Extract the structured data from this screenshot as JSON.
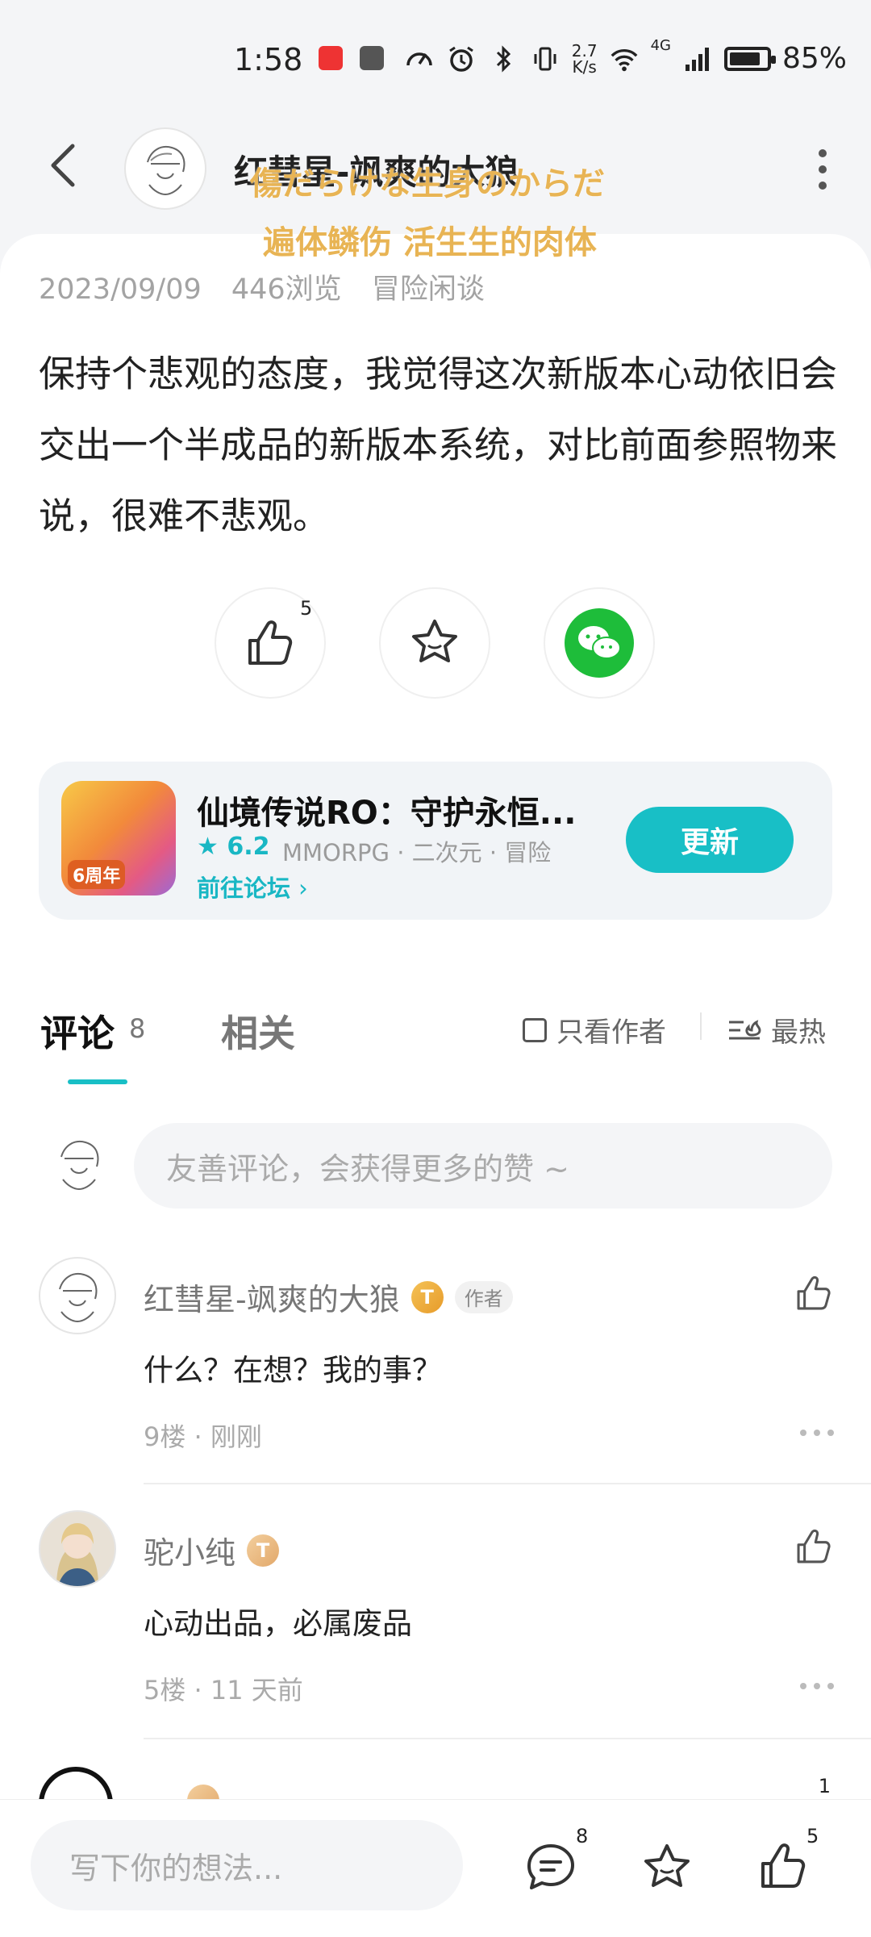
{
  "status_bar": {
    "time": "1:58",
    "speed": "2.7\nK/s",
    "network": "4G",
    "battery": "85%",
    "battery_level": 0.85
  },
  "header": {
    "title": "红彗星-飒爽的大狼",
    "overlay_line1": "傷だらけな生身のからだ",
    "overlay_line2": "遍体鳞伤 活生生的肉体"
  },
  "post": {
    "date": "2023/09/09",
    "views": "446浏览",
    "category": "冒险闲谈",
    "body": "保持个悲观的态度，我觉得这次新版本心动依旧会交出一个半成品的新版本系统，对比前面参照物来说，很难不悲观。",
    "like_count": "5"
  },
  "game_card": {
    "title": "仙境传说RO：守护永恒...",
    "rating": "6.2",
    "tags": "MMORPG · 二次元 · 冒险",
    "link": "前往论坛",
    "button": "更新",
    "icon_text": "6周年"
  },
  "comments_section": {
    "tab_comments": "评论",
    "comment_count": "8",
    "tab_related": "相关",
    "only_author": "只看作者",
    "sort": "最热",
    "input_placeholder": "友善评论，会获得更多的赞 ~"
  },
  "comments": [
    {
      "name": "红彗星-飒爽的大狼",
      "level": "T",
      "tag": "作者",
      "text": "什么？在想？我的事？",
      "meta": "9楼 · 刚刚"
    },
    {
      "name": "驼小纯",
      "level": "T",
      "text": "心动出品，必属废品",
      "meta": "5楼 · 11 天前"
    },
    {
      "partial_like_count": "1"
    }
  ],
  "bottom_bar": {
    "placeholder": "写下你的想法...",
    "comment_count": "8",
    "like_count": "5"
  }
}
